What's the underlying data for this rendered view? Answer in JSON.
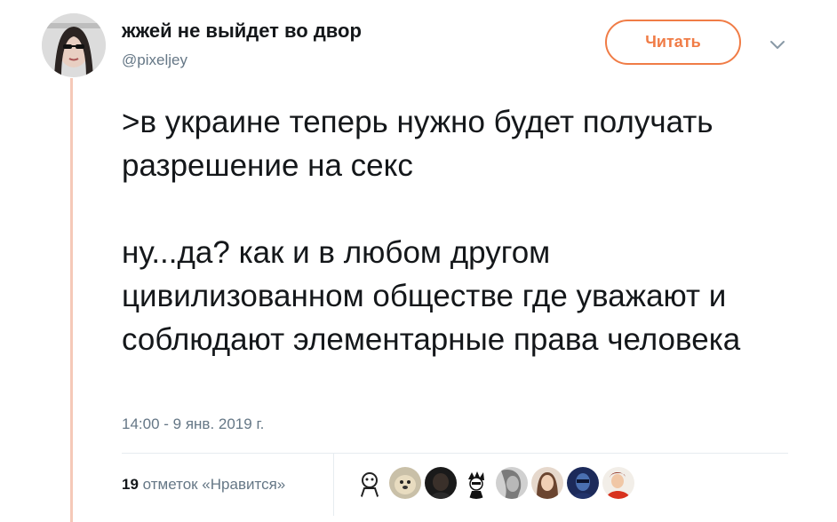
{
  "author": {
    "display_name": "жжей не выйдет во двор",
    "handle": "@pixeljey"
  },
  "follow_button": {
    "label": "Читать"
  },
  "tweet": {
    "paragraphs": [
      ">в украине теперь нужно будет получать разрешение на секс",
      "ну...да? как и в любом другом цивилизованном обществе где уважают и соблюдают элементарные права человека"
    ],
    "timestamp": "14:00 - 9 янв. 2019 г."
  },
  "likes": {
    "count": "19",
    "label": "отметок «Нравится»"
  },
  "likers": [
    {
      "icon": "sketch-avatar"
    },
    {
      "icon": "dog-avatar"
    },
    {
      "icon": "dark-avatar"
    },
    {
      "icon": "cartoon-avatar"
    },
    {
      "icon": "bw-portrait-avatar"
    },
    {
      "icon": "woman-avatar"
    },
    {
      "icon": "blue-avatar"
    },
    {
      "icon": "red-avatar"
    }
  ],
  "colors": {
    "accent": "#f07c46",
    "thread_line": "#f5c9b8",
    "muted_text": "#657786",
    "text": "#14171a"
  }
}
